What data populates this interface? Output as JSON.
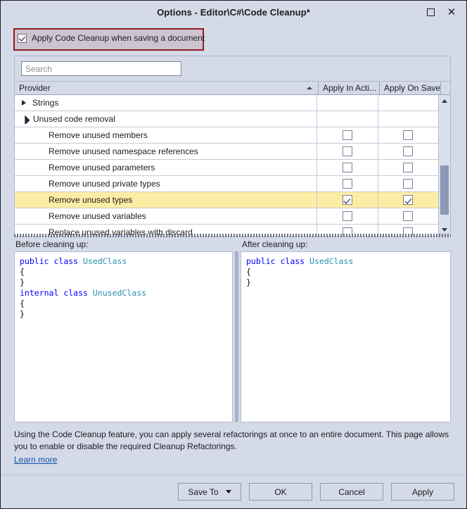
{
  "window": {
    "title": "Options - Editor\\C#\\Code Cleanup*",
    "buttons": {
      "maximize": "maximize-button",
      "close": "close-button"
    }
  },
  "apply_on_save": {
    "label": "Apply Code Cleanup when saving a document",
    "checked": true
  },
  "search": {
    "value": "",
    "placeholder": "Search"
  },
  "grid": {
    "columns": [
      {
        "key": "provider",
        "label": "Provider",
        "sorted": "ascending"
      },
      {
        "key": "apply_in_action",
        "label": "Apply In Acti..."
      },
      {
        "key": "apply_on_save",
        "label": "Apply On Save"
      }
    ],
    "rows": [
      {
        "label": "Strings",
        "kind": "group",
        "expanded": false
      },
      {
        "label": "Unused code removal",
        "kind": "group",
        "expanded": true
      },
      {
        "label": "Remove unused members",
        "kind": "child",
        "apply_in_action": false,
        "apply_on_save": false,
        "selected": false
      },
      {
        "label": "Remove unused namespace references",
        "kind": "child",
        "apply_in_action": false,
        "apply_on_save": false,
        "selected": false
      },
      {
        "label": "Remove unused parameters",
        "kind": "child",
        "apply_in_action": false,
        "apply_on_save": false,
        "selected": false
      },
      {
        "label": "Remove unused private types",
        "kind": "child",
        "apply_in_action": false,
        "apply_on_save": false,
        "selected": false
      },
      {
        "label": "Remove unused types",
        "kind": "child",
        "apply_in_action": true,
        "apply_on_save": true,
        "selected": true
      },
      {
        "label": "Remove unused variables",
        "kind": "child",
        "apply_in_action": false,
        "apply_on_save": false,
        "selected": false
      },
      {
        "label": "Replace unused variables with discard",
        "kind": "child",
        "apply_in_action": false,
        "apply_on_save": false,
        "selected": false
      }
    ]
  },
  "preview": {
    "before": {
      "label": "Before cleaning up:",
      "lines": [
        [
          {
            "t": "public",
            "c": "kw"
          },
          {
            "t": " "
          },
          {
            "t": "class",
            "c": "kw"
          },
          {
            "t": " "
          },
          {
            "t": "UsedClass",
            "c": "typ"
          }
        ],
        [
          {
            "t": "{"
          }
        ],
        [
          {
            "t": "}"
          }
        ],
        [
          {
            "t": "internal",
            "c": "kw"
          },
          {
            "t": " "
          },
          {
            "t": "class",
            "c": "kw"
          },
          {
            "t": " "
          },
          {
            "t": "UnusedClass",
            "c": "typ"
          }
        ],
        [
          {
            "t": "{"
          }
        ],
        [
          {
            "t": "}"
          }
        ]
      ]
    },
    "after": {
      "label": "After cleaning up:",
      "lines": [
        [
          {
            "t": "public",
            "c": "kw"
          },
          {
            "t": " "
          },
          {
            "t": "class",
            "c": "kw"
          },
          {
            "t": " "
          },
          {
            "t": "UsedClass",
            "c": "typ"
          }
        ],
        [
          {
            "t": "{"
          }
        ],
        [
          {
            "t": "}"
          }
        ]
      ]
    }
  },
  "description": {
    "text": "Using the Code Cleanup feature, you can apply several refactorings at once to an entire document. This page allows you to enable or disable the required Cleanup Refactorings.",
    "link": "Learn more"
  },
  "footer_buttons": {
    "save_to": "Save To",
    "ok": "OK",
    "cancel": "Cancel",
    "apply": "Apply"
  },
  "colors": {
    "dialog_background": "#d4dae8",
    "selected_row": "#fdeda4",
    "annotation_border": "#8d1d20",
    "link": "#1352a8",
    "code_keyword": "#0000ff",
    "code_type": "#2b91af"
  }
}
